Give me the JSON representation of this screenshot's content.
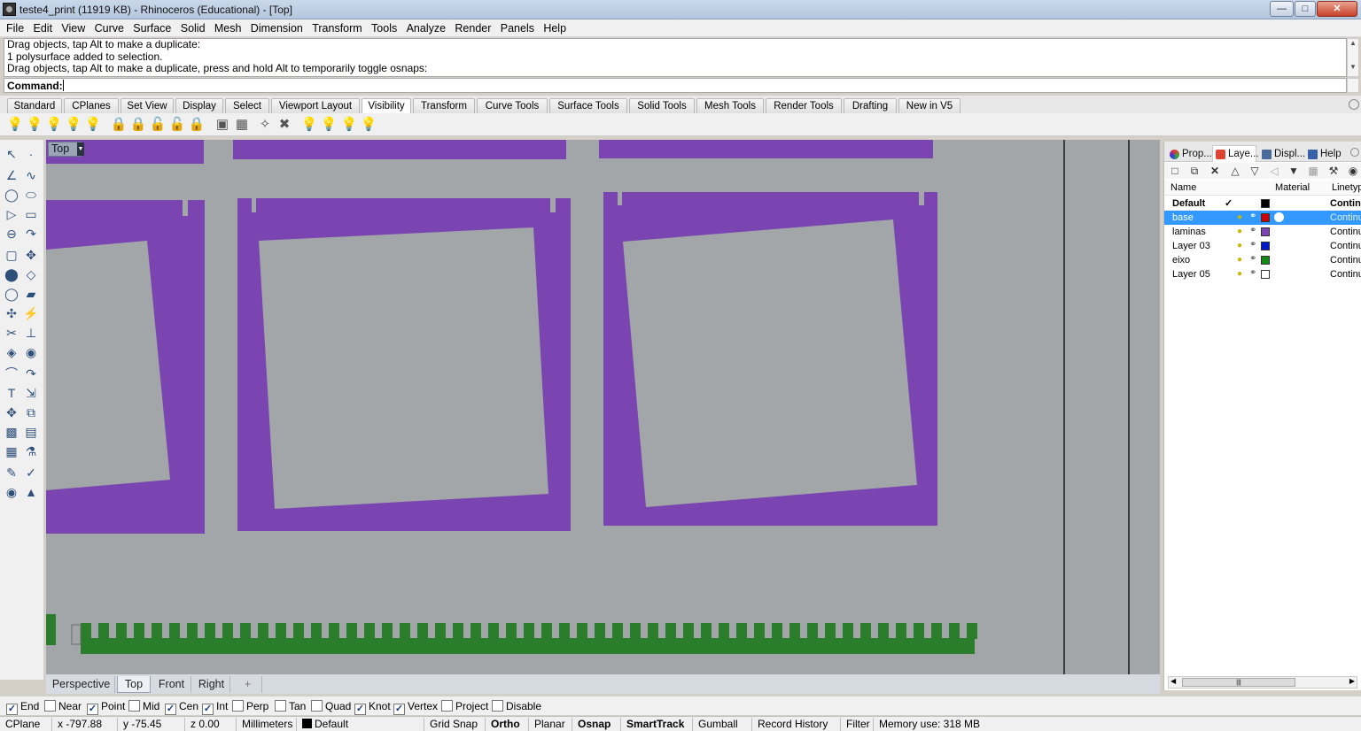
{
  "window": {
    "title": "teste4_print (11919 KB) - Rhinoceros (Educational) - [Top]",
    "minimize_icon": "minimize-icon",
    "maximize_icon": "maximize-icon",
    "close_icon": "close-icon"
  },
  "menu": [
    "File",
    "Edit",
    "View",
    "Curve",
    "Surface",
    "Solid",
    "Mesh",
    "Dimension",
    "Transform",
    "Tools",
    "Analyze",
    "Render",
    "Panels",
    "Help"
  ],
  "command": {
    "history": [
      "Drag objects, tap Alt to make a duplicate:",
      "1 polysurface added to selection.",
      "Drag objects, tap Alt to make a duplicate, press and hold Alt to temporarily toggle osnaps:"
    ],
    "prompt_label": "Command:",
    "input_value": ""
  },
  "toolbar_tabs": [
    "Standard",
    "CPlanes",
    "Set View",
    "Display",
    "Select",
    "Viewport Layout",
    "Visibility",
    "Transform",
    "Curve Tools",
    "Surface Tools",
    "Solid Tools",
    "Mesh Tools",
    "Render Tools",
    "Drafting",
    "New in V5"
  ],
  "active_toolbar_tab": "Visibility",
  "viewport": {
    "label": "Top",
    "tabs": [
      "Perspective",
      "Top",
      "Front",
      "Right"
    ],
    "active_tab": "Top",
    "add_tab_symbol": "+",
    "colors": {
      "background": "#a2a6a9",
      "laminas": "#7a45b0",
      "eixo": "#2a7d2a"
    }
  },
  "panel": {
    "tabs": [
      {
        "label": "Prop...",
        "icon": "properties-icon"
      },
      {
        "label": "Laye...",
        "icon": "layers-icon"
      },
      {
        "label": "Displ...",
        "icon": "display-icon"
      },
      {
        "label": "Help",
        "icon": "help-icon"
      }
    ],
    "active_tab": "Laye...",
    "columns": {
      "name": "Name",
      "material": "Material",
      "linetype": "Linetyp"
    },
    "layers": [
      {
        "name": "Default",
        "current_mark": "✓",
        "color": "#000000",
        "linetype": "Contin",
        "selected": false,
        "bold": true
      },
      {
        "name": "base",
        "color": "#cc0000",
        "linetype": "Continu",
        "selected": true
      },
      {
        "name": "laminas",
        "color": "#7a45b0",
        "linetype": "Continu",
        "selected": false
      },
      {
        "name": "Layer 03",
        "color": "#0018c8",
        "linetype": "Continu",
        "selected": false
      },
      {
        "name": "eixo",
        "color": "#138a13",
        "linetype": "Continu",
        "selected": false
      },
      {
        "name": "Layer 05",
        "color": "#ffffff",
        "linetype": "Continu",
        "selected": false
      }
    ],
    "scroll_grip": "|||"
  },
  "osnaps": [
    {
      "label": "End",
      "checked": true
    },
    {
      "label": "Near",
      "checked": false
    },
    {
      "label": "Point",
      "checked": true
    },
    {
      "label": "Mid",
      "checked": false
    },
    {
      "label": "Cen",
      "checked": true
    },
    {
      "label": "Int",
      "checked": true
    },
    {
      "label": "Perp",
      "checked": false
    },
    {
      "label": "Tan",
      "checked": false
    },
    {
      "label": "Quad",
      "checked": false
    },
    {
      "label": "Knot",
      "checked": true
    },
    {
      "label": "Vertex",
      "checked": true
    },
    {
      "label": "Project",
      "checked": false
    },
    {
      "label": "Disable",
      "checked": false
    }
  ],
  "status": {
    "cplane": "CPlane",
    "x": "x -797.88",
    "y": "y -75.45",
    "z": "z 0.00",
    "units": "Millimeters",
    "layer": "Default",
    "grid_snap": "Grid Snap",
    "ortho": "Ortho",
    "planar": "Planar",
    "osnap": "Osnap",
    "smarttrack": "SmartTrack",
    "gumball": "Gumball",
    "record_history": "Record History",
    "filter": "Filter",
    "memory": "Memory use: 318 MB"
  }
}
